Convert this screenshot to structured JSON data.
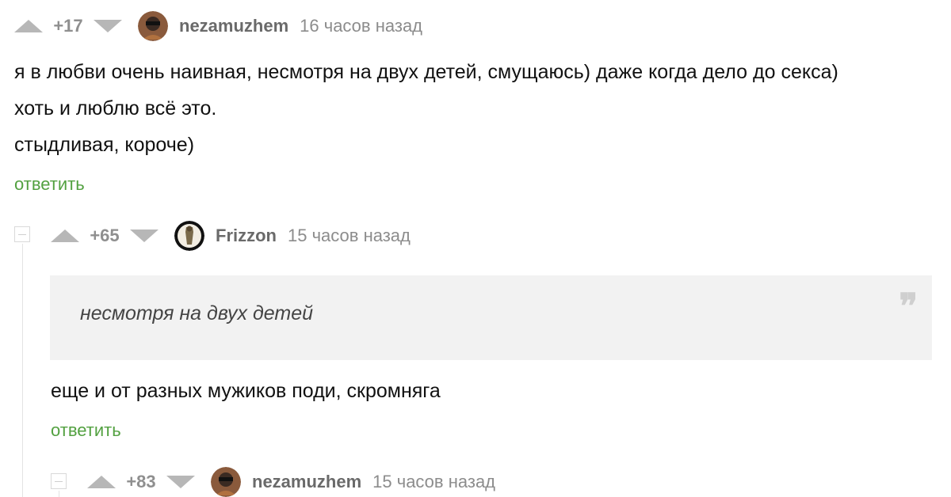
{
  "comments": [
    {
      "rating": "+17",
      "username": "nezamuzhem",
      "time": "16 часов назад",
      "lines": [
        "я в любви очень наивная, несмотря на двух детей, смущаюсь) даже когда дело до секса)",
        "хоть и люблю всё это.",
        "стыдливая, короче)"
      ],
      "reply_label": "ответить"
    },
    {
      "rating": "+65",
      "username": "Frizzon",
      "time": "15 часов назад",
      "quote": "несмотря на двух детей",
      "text": "еще и от разных мужиков поди, скромняга",
      "reply_label": "ответить"
    },
    {
      "rating": "+83",
      "username": "nezamuzhem",
      "time": "15 часов назад"
    }
  ],
  "icons": {
    "upvote": "triangle-up-icon",
    "downvote": "triangle-down-icon",
    "collapse": "minus-box-icon",
    "quote": "quote-marks-icon"
  },
  "colors": {
    "reply": "#53a141",
    "vote": "#b7b7b7",
    "quote_bg": "#f2f2f2"
  }
}
